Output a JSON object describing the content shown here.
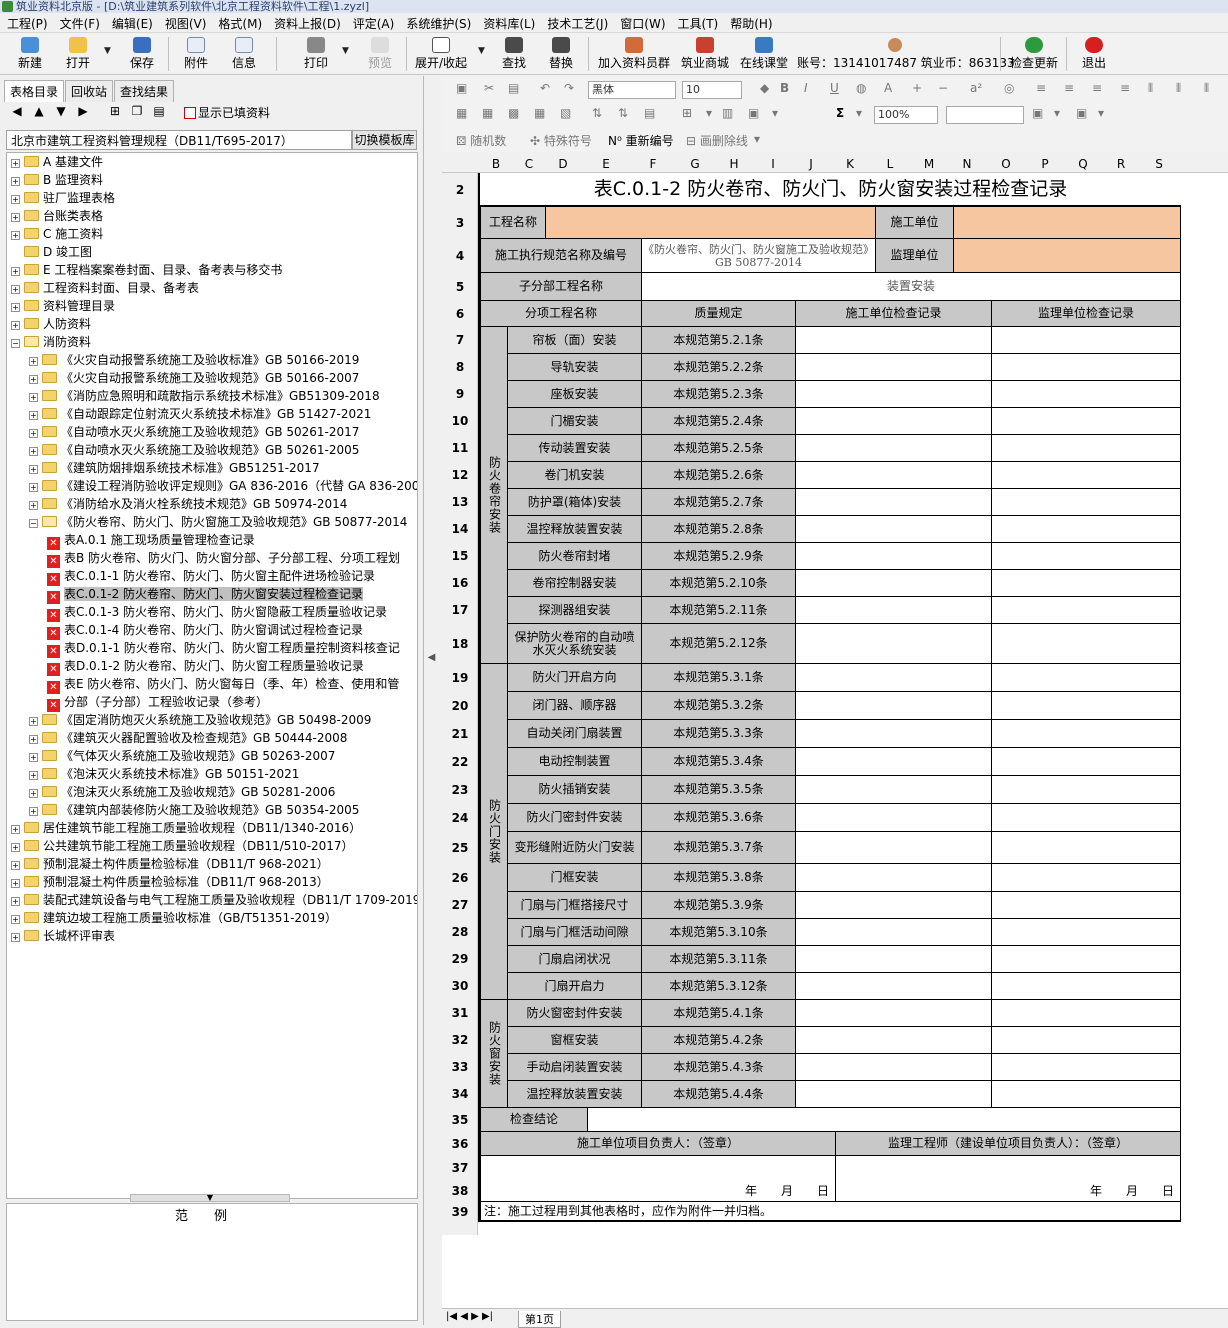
{
  "window": {
    "title": "筑业资料北京版 - [D:\\筑业建筑系列软件\\北京工程资料软件\\工程\\1.zyzl]"
  },
  "menu": [
    "工程(P)",
    "文件(F)",
    "编辑(E)",
    "视图(V)",
    "格式(M)",
    "资料上报(D)",
    "评定(A)",
    "系统维护(S)",
    "资料库(L)",
    "技术工艺(J)",
    "窗口(W)",
    "工具(T)",
    "帮助(H)"
  ],
  "toolbar": {
    "new": "新建",
    "open": "打开",
    "save": "保存",
    "attach": "附件",
    "info": "信息",
    "print": "打印",
    "preview": "预览",
    "expand": "展开/收起",
    "find": "查找",
    "replace": "替换",
    "join_group": "加入资料员群",
    "mall": "筑业商城",
    "classroom": "在线课堂",
    "account": "账号：13141017487 筑业币：863133",
    "check_update": "检查更新",
    "exit": "退出"
  },
  "left": {
    "tabs": [
      "表格目录",
      "回收站",
      "查找结果"
    ],
    "show_filled": "显示已填资料",
    "spec": "北京市建筑工程资料管理规程（DB11/T695-2017）",
    "switch_template": "切换模板库",
    "example_label": "范　　例"
  },
  "tree": [
    {
      "level": 0,
      "kind": "folder",
      "label": "A 基建文件"
    },
    {
      "level": 0,
      "kind": "folder",
      "label": "B 监理资料"
    },
    {
      "level": 0,
      "kind": "folder",
      "label": "驻厂监理表格"
    },
    {
      "level": 0,
      "kind": "folder",
      "label": "台账类表格"
    },
    {
      "level": 0,
      "kind": "folder",
      "label": "C 施工资料"
    },
    {
      "level": 0,
      "kind": "folder",
      "label": "D 竣工图",
      "noexp": true
    },
    {
      "level": 0,
      "kind": "folder",
      "label": "E 工程档案案卷封面、目录、备考表与移交书"
    },
    {
      "level": 0,
      "kind": "folder",
      "label": "工程资料封面、目录、备考表"
    },
    {
      "level": 0,
      "kind": "folder",
      "label": "资料管理目录"
    },
    {
      "level": 0,
      "kind": "folder",
      "label": "人防资料"
    },
    {
      "level": 0,
      "kind": "folder",
      "label": "消防资料",
      "open": true
    },
    {
      "level": 1,
      "kind": "folder",
      "label": "《火灾自动报警系统施工及验收标准》GB 50166-2019"
    },
    {
      "level": 1,
      "kind": "folder",
      "label": "《火灾自动报警系统施工及验收规范》GB 50166-2007"
    },
    {
      "level": 1,
      "kind": "folder",
      "label": "《消防应急照明和疏散指示系统技术标准》GB51309-2018"
    },
    {
      "level": 1,
      "kind": "folder",
      "label": "《自动跟踪定位射流灭火系统技术标准》GB 51427-2021"
    },
    {
      "level": 1,
      "kind": "folder",
      "label": "《自动喷水灭火系统施工及验收规范》GB 50261-2017"
    },
    {
      "level": 1,
      "kind": "folder",
      "label": "《自动喷水灭火系统施工及验收规范》GB 50261-2005"
    },
    {
      "level": 1,
      "kind": "folder",
      "label": "《建筑防烟排烟系统技术标准》GB51251-2017"
    },
    {
      "level": 1,
      "kind": "folder",
      "label": "《建设工程消防验收评定规则》GA 836-2016（代替 GA 836-2009）"
    },
    {
      "level": 1,
      "kind": "folder",
      "label": "《消防给水及消火栓系统技术规范》GB 50974-2014"
    },
    {
      "level": 1,
      "kind": "folder",
      "label": "《防火卷帘、防火门、防火窗施工及验收规范》GB 50877-2014",
      "open": true
    },
    {
      "level": 2,
      "kind": "doc",
      "label": "表A.0.1 施工现场质量管理检查记录"
    },
    {
      "level": 2,
      "kind": "doc",
      "label": "表B 防火卷帘、防火门、防火窗分部、子分部工程、分项工程划"
    },
    {
      "level": 2,
      "kind": "doc",
      "label": "表C.0.1-1 防火卷帘、防火门、防火窗主配件进场检验记录"
    },
    {
      "level": 2,
      "kind": "doc",
      "label": "表C.0.1-2 防火卷帘、防火门、防火窗安装过程检查记录",
      "selected": true
    },
    {
      "level": 2,
      "kind": "doc",
      "label": "表C.0.1-3 防火卷帘、防火门、防火窗隐蔽工程质量验收记录"
    },
    {
      "level": 2,
      "kind": "doc",
      "label": "表C.0.1-4 防火卷帘、防火门、防火窗调试过程检查记录"
    },
    {
      "level": 2,
      "kind": "doc",
      "label": "表D.0.1-1 防火卷帘、防火门、防火窗工程质量控制资料核查记"
    },
    {
      "level": 2,
      "kind": "doc",
      "label": "表D.0.1-2 防火卷帘、防火门、防火窗工程质量验收记录"
    },
    {
      "level": 2,
      "kind": "doc",
      "label": "表E 防火卷帘、防火门、防火窗每日（季、年）检查、使用和管"
    },
    {
      "level": 2,
      "kind": "doc",
      "label": "分部（子分部）工程验收记录（参考）"
    },
    {
      "level": 1,
      "kind": "folder",
      "label": "《固定消防炮灭火系统施工及验收规范》GB 50498-2009"
    },
    {
      "level": 1,
      "kind": "folder",
      "label": "《建筑灭火器配置验收及检查规范》GB 50444-2008"
    },
    {
      "level": 1,
      "kind": "folder",
      "label": "《气体灭火系统施工及验收规范》GB 50263-2007"
    },
    {
      "level": 1,
      "kind": "folder",
      "label": "《泡沫灭火系统技术标准》GB 50151-2021"
    },
    {
      "level": 1,
      "kind": "folder",
      "label": "《泡沫灭火系统施工及验收规范》GB 50281-2006"
    },
    {
      "level": 1,
      "kind": "folder",
      "label": "《建筑内部装修防火施工及验收规范》GB 50354-2005"
    },
    {
      "level": 0,
      "kind": "folder",
      "label": "居住建筑节能工程施工质量验收规程（DB11/1340-2016）"
    },
    {
      "level": 0,
      "kind": "folder",
      "label": "公共建筑节能工程施工质量验收规程（DB11/510-2017）"
    },
    {
      "level": 0,
      "kind": "folder",
      "label": "预制混凝土构件质量检验标准（DB11/T 968-2021）"
    },
    {
      "level": 0,
      "kind": "folder",
      "label": "预制混凝土构件质量检验标准（DB11/T 968-2013）"
    },
    {
      "level": 0,
      "kind": "folder",
      "label": "装配式建筑设备与电气工程施工质量及验收规程（DB11/T 1709-2019）"
    },
    {
      "level": 0,
      "kind": "folder",
      "label": "建筑边坡工程施工质量验收标准（GB/T51351-2019）"
    },
    {
      "level": 0,
      "kind": "folder",
      "label": "长城杯评审表"
    }
  ],
  "format": {
    "font": "黑体",
    "size": "10",
    "zoom": "100%",
    "random": "随机数",
    "special": "特殊符号",
    "renumber": "重新编号",
    "strike": "画删除线"
  },
  "columns": [
    "B",
    "C",
    "D",
    "E",
    "F",
    "G",
    "H",
    "I",
    "J",
    "K",
    "L",
    "M",
    "N",
    "O",
    "P",
    "Q",
    "R",
    "S"
  ],
  "sheet": {
    "tab": "第1页",
    "title": "表C.0.1-2  防火卷帘、防火门、防火窗安装过程检查记录",
    "project_name_label": "工程名称",
    "contractor_label": "施工单位",
    "spec_label": "施工执行规范名称及编号",
    "spec_value": "《防火卷帘、防火门、防火窗施工及验收规范》GB 50877-2014",
    "supervisor_label": "监理单位",
    "subproject_label": "子分部工程名称",
    "subproject_value": "装置安装",
    "h_item": "分项工程名称",
    "h_quality": "质量规定",
    "h_contractor_record": "施工单位检查记录",
    "h_supervisor_record": "监理单位检查记录",
    "groups": [
      "防火卷帘安装",
      "防火门安装",
      "防火窗安装"
    ],
    "items": [
      [
        "帘板（面）安装",
        "本规范第5.2.1条"
      ],
      [
        "导轨安装",
        "本规范第5.2.2条"
      ],
      [
        "座板安装",
        "本规范第5.2.3条"
      ],
      [
        "门楣安装",
        "本规范第5.2.4条"
      ],
      [
        "传动装置安装",
        "本规范第5.2.5条"
      ],
      [
        "卷门机安装",
        "本规范第5.2.6条"
      ],
      [
        "防护罩(箱体)安装",
        "本规范第5.2.7条"
      ],
      [
        "温控释放装置安装",
        "本规范第5.2.8条"
      ],
      [
        "防火卷帘封堵",
        "本规范第5.2.9条"
      ],
      [
        "卷帘控制器安装",
        "本规范第5.2.10条"
      ],
      [
        "探测器组安装",
        "本规范第5.2.11条"
      ],
      [
        "保护防火卷帘的自动喷水灭火系统安装",
        "本规范第5.2.12条"
      ],
      [
        "防火门开启方向",
        "本规范第5.3.1条"
      ],
      [
        "闭门器、顺序器",
        "本规范第5.3.2条"
      ],
      [
        "自动关闭门扇装置",
        "本规范第5.3.3条"
      ],
      [
        "电动控制装置",
        "本规范第5.3.4条"
      ],
      [
        "防火插销安装",
        "本规范第5.3.5条"
      ],
      [
        "防火门密封件安装",
        "本规范第5.3.6条"
      ],
      [
        "变形缝附近防火门安装",
        "本规范第5.3.7条"
      ],
      [
        "门框安装",
        "本规范第5.3.8条"
      ],
      [
        "门扇与门框搭接尺寸",
        "本规范第5.3.9条"
      ],
      [
        "门扇与门框活动间隙",
        "本规范第5.3.10条"
      ],
      [
        "门扇启闭状况",
        "本规范第5.3.11条"
      ],
      [
        "门扇开启力",
        "本规范第5.3.12条"
      ],
      [
        "防火窗密封件安装",
        "本规范第5.4.1条"
      ],
      [
        "窗框安装",
        "本规范第5.4.2条"
      ],
      [
        "手动启闭装置安装",
        "本规范第5.4.3条"
      ],
      [
        "温控释放装置安装",
        "本规范第5.4.4条"
      ]
    ],
    "conclusion_label": "检查结论",
    "sign_contractor": "施工单位项目负责人：（签章）",
    "sign_supervisor": "监理工程师（建设单位项目负责人）：（签章）",
    "date_label": "年　　月　　日",
    "note": "注：施工过程用到其他表格时，应作为附件一并归档。",
    "row_numbers": [
      "2",
      "3",
      "4",
      "5",
      "6",
      "7",
      "8",
      "9",
      "10",
      "11",
      "12",
      "13",
      "14",
      "15",
      "16",
      "17",
      "18",
      "19",
      "20",
      "21",
      "22",
      "23",
      "24",
      "25",
      "26",
      "27",
      "28",
      "29",
      "30",
      "31",
      "32",
      "33",
      "34",
      "35",
      "36",
      "37",
      "38",
      "39"
    ]
  },
  "colors": {
    "peach": "#f5c6a0",
    "gray": "#c8c8c8",
    "selection": "#c0c0c0"
  }
}
